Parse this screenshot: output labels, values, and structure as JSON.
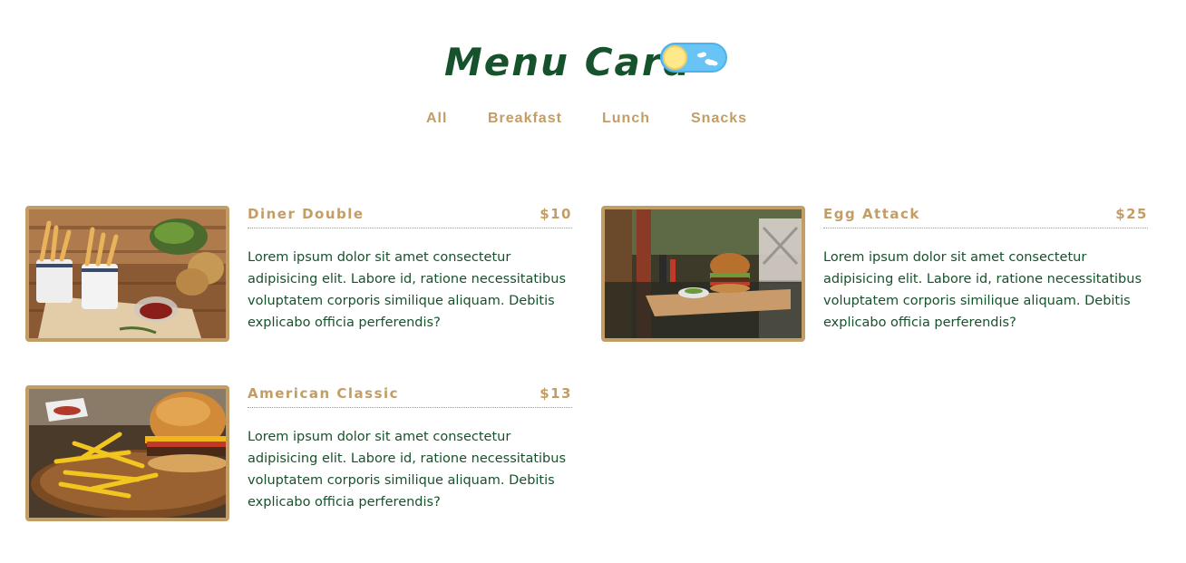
{
  "header": {
    "title": "Menu Card",
    "theme_toggle": "sun-cloud-toggle"
  },
  "nav": {
    "items": [
      {
        "label": "All"
      },
      {
        "label": "Breakfast"
      },
      {
        "label": "Lunch"
      },
      {
        "label": "Snacks"
      }
    ]
  },
  "menu": {
    "items": [
      {
        "name": "Diner Double",
        "price": "$10",
        "description": "Lorem ipsum dolor sit amet consectetur adipisicing elit. Labore id, ratione necessitatibus voluptatem corporis similique aliquam. Debitis explicabo officia perferendis?",
        "image": "fries-and-potatoes-photo"
      },
      {
        "name": "Egg Attack",
        "price": "$25",
        "description": "Lorem ipsum dolor sit amet consectetur adipisicing elit. Labore id, ratione necessitatibus voluptatem corporis similique aliquam. Debitis explicabo officia perferendis?",
        "image": "burger-on-tray-photo"
      },
      {
        "name": "American Classic",
        "price": "$13",
        "description": "Lorem ipsum dolor sit amet consectetur adipisicing elit. Labore id, ratione necessitatibus voluptatem corporis similique aliquam. Debitis explicabo officia perferendis?",
        "image": "cheeseburger-and-fries-photo"
      }
    ]
  },
  "colors": {
    "title": "#16522b",
    "accent": "#c29d66",
    "text": "#16522b",
    "toggle_sky": "#67c4f5",
    "toggle_sun": "#ffe98a"
  }
}
